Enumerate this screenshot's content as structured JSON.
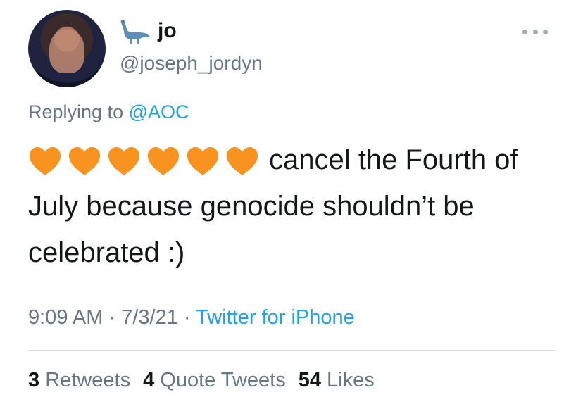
{
  "user": {
    "display_name": "jo",
    "handle": "@joseph_jordyn",
    "badge_icon": "dinosaur-icon",
    "avatar_icon": "avatar"
  },
  "reply": {
    "prefix": "Replying to",
    "mention": "@AOC"
  },
  "tweet": {
    "emoji_icon": "orange-heart-icon",
    "emoji_count": 6,
    "emoji_color": "#f7931e",
    "text": "cancel the Fourth of July because genocide shouldn’t be celebrated :)"
  },
  "meta": {
    "time": "9:09 AM",
    "sep1": "·",
    "date": "7/3/21",
    "sep2": "·",
    "source": "Twitter for iPhone"
  },
  "stats": {
    "retweets_count": "3",
    "retweets_label": "Retweets",
    "quote_count": "4",
    "quote_label": "Quote Tweets",
    "likes_count": "54",
    "likes_label": "Likes"
  },
  "colors": {
    "link": "#1da1f2",
    "secondary_text": "#657786",
    "primary_text": "#14171a"
  }
}
